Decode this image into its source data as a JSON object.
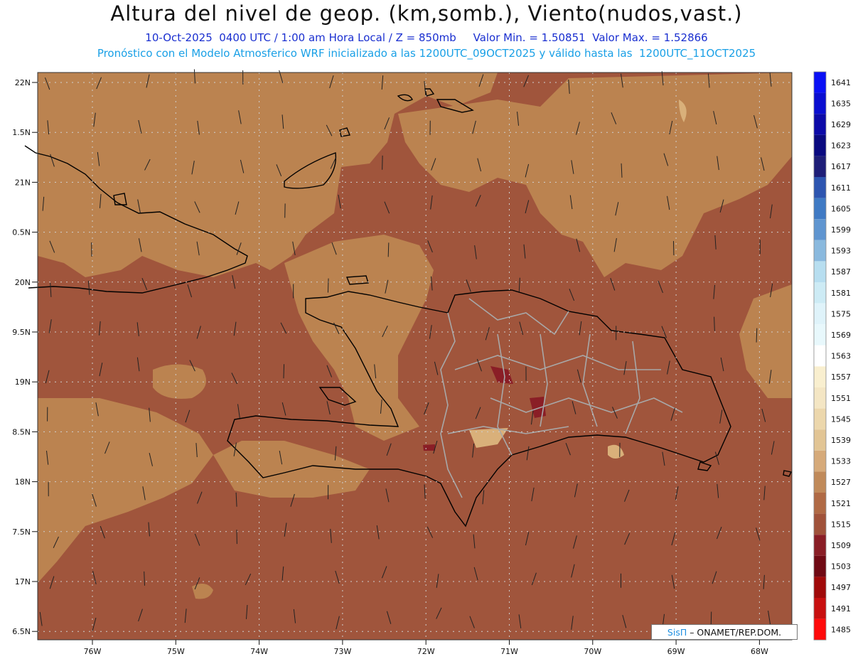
{
  "header": {
    "title": "Altura del nivel de geop. (km,somb.), Viento(nudos,vast.)",
    "subtitle1": "10-Oct-2025  0400 UTC / 1:00 am Hora Local / Z = 850mb     Valor Min. = 1.50851  Valor Max. = 1.52866",
    "subtitle2": "Pronóstico con el Modelo Atmosferico WRF inicializado a las 1200UTC_09OCT2025 y válido hasta las  1200UTC_11OCT2025"
  },
  "axes": {
    "lat_labels": [
      "22N",
      "1.5N",
      "21N",
      "0.5N",
      "20N",
      "9.5N",
      "19N",
      "8.5N",
      "18N",
      "7.5N",
      "17N",
      "6.5N"
    ],
    "lon_labels": [
      "76W",
      "75W",
      "74W",
      "73W",
      "72W",
      "71W",
      "70W",
      "69W",
      "68W"
    ]
  },
  "colorbar": {
    "labels": [
      "1641",
      "1635",
      "1629",
      "1623",
      "1617",
      "1611",
      "1605",
      "1599",
      "1593",
      "1587",
      "1581",
      "1575",
      "1569",
      "1563",
      "1557",
      "1551",
      "1545",
      "1539",
      "1533",
      "1527",
      "1521",
      "1515",
      "1509",
      "1503",
      "1497",
      "1491",
      "1485"
    ],
    "colors": [
      "#0a10f5",
      "#0a0ed0",
      "#0c0aa8",
      "#0a0a80",
      "#1e1e78",
      "#2d55b0",
      "#3f7ac4",
      "#5f95d0",
      "#8ab9de",
      "#b7def0",
      "#cdebf5",
      "#dff3fa",
      "#e8f8fc",
      "#ffffff",
      "#f9efcf",
      "#f4e6c4",
      "#ecd7ac",
      "#e2c595",
      "#d6aa7a",
      "#c08a5a",
      "#b06a45",
      "#a0523a",
      "#8a1e26",
      "#700a14",
      "#a00a0a",
      "#c81010",
      "#ff0a0a"
    ]
  },
  "map_colors": {
    "ocean_level": "#a0553c",
    "land_level": "#bb8350",
    "high_level": "#d9b07a",
    "low_level": "#8a1e26",
    "coast": "#000000",
    "borders": "#a0a0a0"
  },
  "credit": {
    "brand": "SisΠ",
    "org": " – ONAMET/REP.DOM."
  }
}
